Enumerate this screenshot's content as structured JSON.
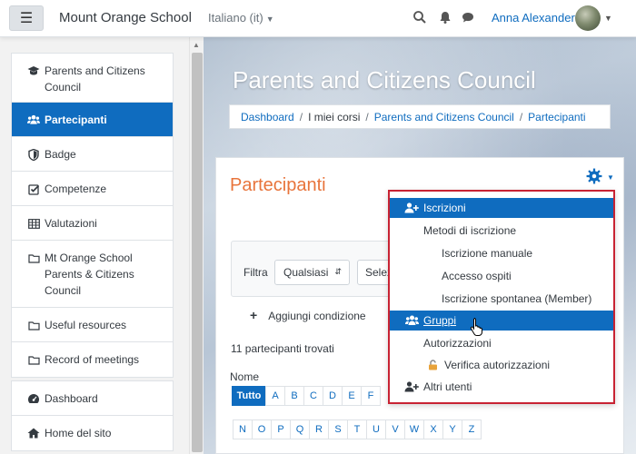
{
  "navbar": {
    "menu_icon": "hamburger-icon",
    "brand": "Mount Orange School",
    "language": "Italiano (it)",
    "icons": [
      "search-icon",
      "bell-icon",
      "chat-icon"
    ],
    "user_name": "Anna Alexander"
  },
  "drawer": {
    "items": [
      {
        "label": "Parents and Citizens Council",
        "icon": "graduation-cap-icon"
      },
      {
        "label": "Partecipanti",
        "icon": "users-icon",
        "active": true
      },
      {
        "label": "Badge",
        "icon": "shield-icon"
      },
      {
        "label": "Competenze",
        "icon": "checkbox-icon"
      },
      {
        "label": "Valutazioni",
        "icon": "table-icon"
      },
      {
        "label": "Mt Orange School Parents & Citizens Council",
        "icon": "folder-icon"
      },
      {
        "label": "Useful resources",
        "icon": "folder-icon"
      },
      {
        "label": "Record of meetings",
        "icon": "folder-icon"
      }
    ],
    "items2": [
      {
        "label": "Dashboard",
        "icon": "dashboard-icon"
      },
      {
        "label": "Home del sito",
        "icon": "home-icon"
      }
    ]
  },
  "header": {
    "title": "Parents and Citizens Council",
    "breadcrumb": [
      "Dashboard",
      "I miei corsi",
      "Parents and Citizens Council",
      "Partecipanti"
    ]
  },
  "main": {
    "title": "Partecipanti",
    "filter_label": "Filtra",
    "filter_any": "Qualsiasi",
    "filter_select": "Seleziona",
    "add_condition": "Aggiungi condizione",
    "found": "11 partecipanti trovati",
    "name_label": "Nome",
    "letters_all": "Tutto",
    "letters_row1": [
      "A",
      "B",
      "C",
      "D",
      "E",
      "F"
    ],
    "letters_row2": [
      "N",
      "O",
      "P",
      "Q",
      "R",
      "S",
      "T",
      "U",
      "V",
      "W",
      "X",
      "Y",
      "Z"
    ]
  },
  "menu": {
    "items": [
      {
        "label": "Iscrizioni",
        "icon": "user-plus-icon"
      },
      {
        "label": "Metodi di iscrizione"
      },
      {
        "label": "Iscrizione manuale"
      },
      {
        "label": "Accesso ospiti"
      },
      {
        "label": "Iscrizione spontanea (Member)"
      },
      {
        "label": "Gruppi",
        "icon": "users-icon"
      },
      {
        "label": "Autorizzazioni"
      },
      {
        "label": "Verifica autorizzazioni",
        "icon": "unlock-icon"
      },
      {
        "label": "Altri utenti",
        "icon": "user-plus-icon"
      }
    ]
  },
  "colors": {
    "accent": "#0f6cbf",
    "title_orange": "#e8743b",
    "menu_border": "#c82333"
  }
}
